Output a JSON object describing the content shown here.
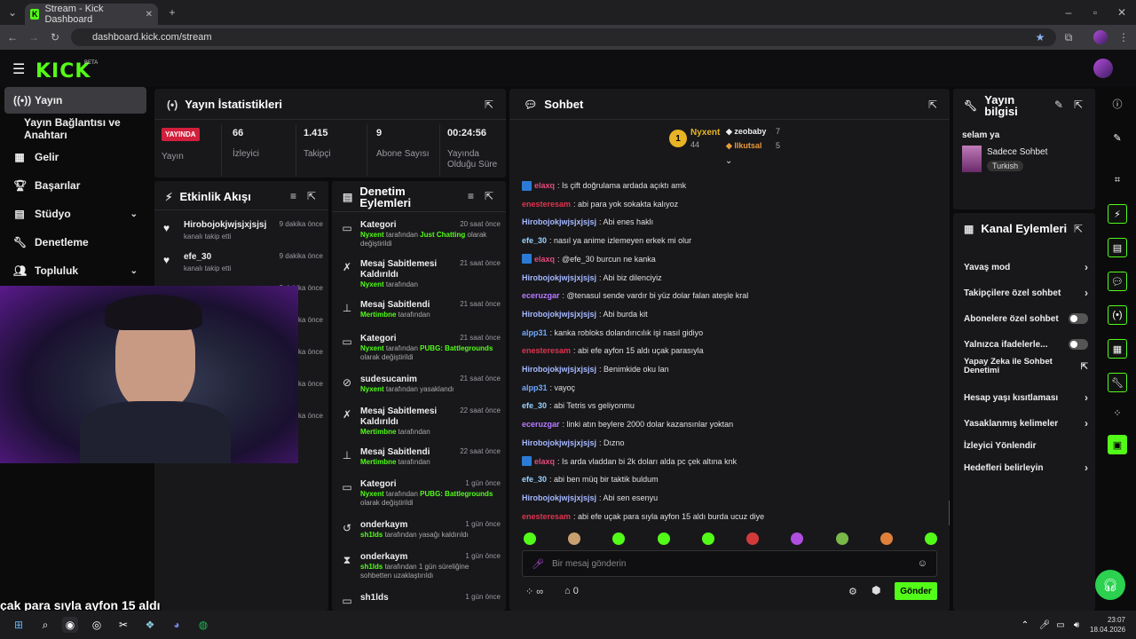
{
  "browser": {
    "tab_title": "Stream - Kick Dashboard",
    "url": "dashboard.kick.com/stream"
  },
  "header": {
    "logo": "KICK",
    "beta": "BETA"
  },
  "sidebar": {
    "items": [
      {
        "label": "Yayın",
        "icon": "broadcast-icon"
      },
      {
        "label": "Yayın Bağlantısı ve Anahtarı",
        "icon": ""
      },
      {
        "label": "Gelir",
        "icon": "revenue-icon"
      },
      {
        "label": "Başarılar",
        "icon": "trophy-icon"
      },
      {
        "label": "Stüdyo",
        "icon": "studio-icon"
      },
      {
        "label": "Denetleme",
        "icon": "wrench-icon"
      },
      {
        "label": "Topluluk",
        "icon": "users-icon"
      }
    ]
  },
  "stats": {
    "title": "Yayın İstatistikleri",
    "live_badge": "YAYINDA",
    "live_label": "Yayın",
    "viewers_value": "66",
    "viewers_label": "İzleyici",
    "followers_value": "1.415",
    "followers_label": "Takipçi",
    "subs_value": "9",
    "subs_label": "Abone Sayısı",
    "uptime_value": "00:24:56",
    "uptime_label": "Yayında Olduğu Süre"
  },
  "activity": {
    "title": "Etkinlik Akışı",
    "items": [
      {
        "name": "Hirobojokjwjsjxjsjsj",
        "desc": "kanalı takip etti",
        "time": "9 dakika önce"
      },
      {
        "name": "efe_30",
        "desc": "kanalı takip etti",
        "time": "9 dakika önce"
      },
      {
        "time": "9 dakika önce"
      },
      {
        "time": "dakika önce"
      },
      {
        "time": "dakika önce"
      },
      {
        "time": "dakika önce"
      },
      {
        "time": "dakika önce"
      }
    ]
  },
  "moderation": {
    "title": "Denetim Eylemleri",
    "items": [
      {
        "icon": "category-icon",
        "name": "Kategori",
        "d1": "Nyxent",
        "d2": " tarafından ",
        "d3": "Just Chatting",
        "d4": " olarak değiştirildi",
        "time": "20 saat önce"
      },
      {
        "icon": "unpin-icon",
        "name": "Mesaj Sabitlemesi Kaldırıldı",
        "d1": "Nyxent",
        "d2": " tarafından",
        "time": "21 saat önce"
      },
      {
        "icon": "pin-icon",
        "name": "Mesaj Sabitlendi",
        "d1": "Mertimbne",
        "d2": " tarafından",
        "time": "21 saat önce"
      },
      {
        "icon": "category-icon",
        "name": "Kategori",
        "d1": "Nyxent",
        "d2": " tarafından ",
        "d3": "PUBG: Battlegrounds",
        "d4": " olarak değiştirildi",
        "time": "21 saat önce"
      },
      {
        "icon": "ban-icon",
        "name": "sudesucanim",
        "d1": "Nyxent",
        "d2": " tarafından yasaklandı",
        "time": "21 saat önce"
      },
      {
        "icon": "unpin-icon",
        "name": "Mesaj Sabitlemesi Kaldırıldı",
        "d1": "Mertimbne",
        "d2": " tarafından",
        "time": "22 saat önce"
      },
      {
        "icon": "pin-icon",
        "name": "Mesaj Sabitlendi",
        "d1": "Mertimbne",
        "d2": " tarafından",
        "time": "22 saat önce"
      },
      {
        "icon": "category-icon",
        "name": "Kategori",
        "d1": "Nyxent",
        "d2": " tarafından ",
        "d3": "PUBG: Battlegrounds",
        "d4": " olarak değiştirildi",
        "time": "1 gün önce"
      },
      {
        "icon": "unban-icon",
        "name": "onderkaym",
        "d1": "sh1lds",
        "d2": " tarafından yasağı kaldırıldı",
        "time": "1 gün önce"
      },
      {
        "icon": "timeout-icon",
        "name": "onderkaym",
        "d1": "sh1lds",
        "d2": " tarafından 1 gün süreliğine sohbetten uzaklaştırıldı",
        "time": "1 gün önce"
      },
      {
        "icon": "category-icon",
        "name": "sh1lds",
        "time": "1 gün önce"
      }
    ]
  },
  "chat": {
    "title": "Sohbet",
    "top_gifter": {
      "name": "Nyxent",
      "count": "44",
      "rank": "1"
    },
    "gifters": [
      {
        "name": "zeobaby",
        "count": "7"
      },
      {
        "name": "llkutsal",
        "count": "5"
      }
    ],
    "messages": [
      {
        "user": "elaxq",
        "color": "#e54a7a",
        "badge": true,
        "text": ": Is çift doğrulama ardada açıktı amk"
      },
      {
        "user": "enesteresam",
        "color": "#e0334d",
        "text": ": abi para yok sokakta kalıyoz"
      },
      {
        "user": "Hirobojokjwjsjxjsjsj",
        "color": "#a5b8ff",
        "text": ": Abi enes haklı"
      },
      {
        "user": "efe_30",
        "color": "#9ad3ff",
        "text": ": nasıl ya anime izlemeyen erkek mi olur"
      },
      {
        "user": "elaxq",
        "color": "#e54a7a",
        "badge": true,
        "text": ": @efe_30 burcun ne kanka"
      },
      {
        "user": "Hirobojokjwjsjxjsjsj",
        "color": "#a5b8ff",
        "text": ": Abi biz dilenciyiz"
      },
      {
        "user": "eceruzgar",
        "color": "#b77bff",
        "text": ": @tenasul sende vardır bi yüz dolar falan ateşle kral"
      },
      {
        "user": "Hirobojokjwjsjxjsjsj",
        "color": "#a5b8ff",
        "text": ": Abi burda kit"
      },
      {
        "user": "alpp31",
        "color": "#6fa8ff",
        "text": ": kanka robloks dolandırıcılık işi nasıl gidiyo"
      },
      {
        "user": "enesteresam",
        "color": "#e0334d",
        "text": ": abi efe ayfon 15 aldı uçak parasıyla"
      },
      {
        "user": "Hirobojokjwjsjxjsjsj",
        "color": "#a5b8ff",
        "text": ": Benimkide oku lan"
      },
      {
        "user": "alpp31",
        "color": "#6fa8ff",
        "text": ": vayoç"
      },
      {
        "user": "efe_30",
        "color": "#9ad3ff",
        "text": ": abi Tetris vs geliyonmu"
      },
      {
        "user": "eceruzgar",
        "color": "#b77bff",
        "text": ": linki atın beylere 2000 dolar kazansınlar yoktan"
      },
      {
        "user": "Hirobojokjwjsjxjsjsj",
        "color": "#a5b8ff",
        "text": ": Dızno"
      },
      {
        "user": "elaxq",
        "color": "#e54a7a",
        "badge": true,
        "text": ": Is arda vladdan bi 2k doları alda pc çek altına knk"
      },
      {
        "user": "efe_30",
        "color": "#9ad3ff",
        "text": ": abi ben müq bir taktik buldum"
      },
      {
        "user": "Hirobojokjwjsjxjsjsj",
        "color": "#a5b8ff",
        "text": ": Abi sen esenyu"
      },
      {
        "user": "enesteresam",
        "color": "#e0334d",
        "text": ": abi efe uçak para sıyla ayfon 15 aldı burda ucuz diye"
      }
    ],
    "input_placeholder": "Bir mesaj gönderin",
    "points": "0",
    "send_label": "Gönder"
  },
  "stream_info": {
    "title": "Yayın bilgisi",
    "stream_title": "selam ya",
    "category": "Sadece Sohbet",
    "language": "Turkish"
  },
  "channel_actions": {
    "title": "Kanal Eylemleri",
    "items": [
      {
        "label": "Yavaş mod",
        "control": "arrow"
      },
      {
        "label": "Takipçilere özel sohbet",
        "control": "arrow"
      },
      {
        "label": "Abonelere özel sohbet",
        "control": "toggle"
      },
      {
        "label": "Yalnızca ifadelerle...",
        "control": "toggle"
      },
      {
        "label": "Yapay Zeka ile Sohbet Denetimi",
        "control": "external"
      },
      {
        "label": "Hesap yaşı kısıtlaması",
        "control": "arrow"
      },
      {
        "label": "Yasaklanmış kelimeler",
        "control": "arrow"
      },
      {
        "label": "İzleyici Yönlendir",
        "control": "none"
      },
      {
        "label": "Hedefleri belirleyin",
        "control": "arrow"
      }
    ]
  },
  "overlay_caption": "çak para sıyla ayfon 15 aldı",
  "taskbar": {
    "time": "23:07",
    "date": "18.04.2026"
  }
}
